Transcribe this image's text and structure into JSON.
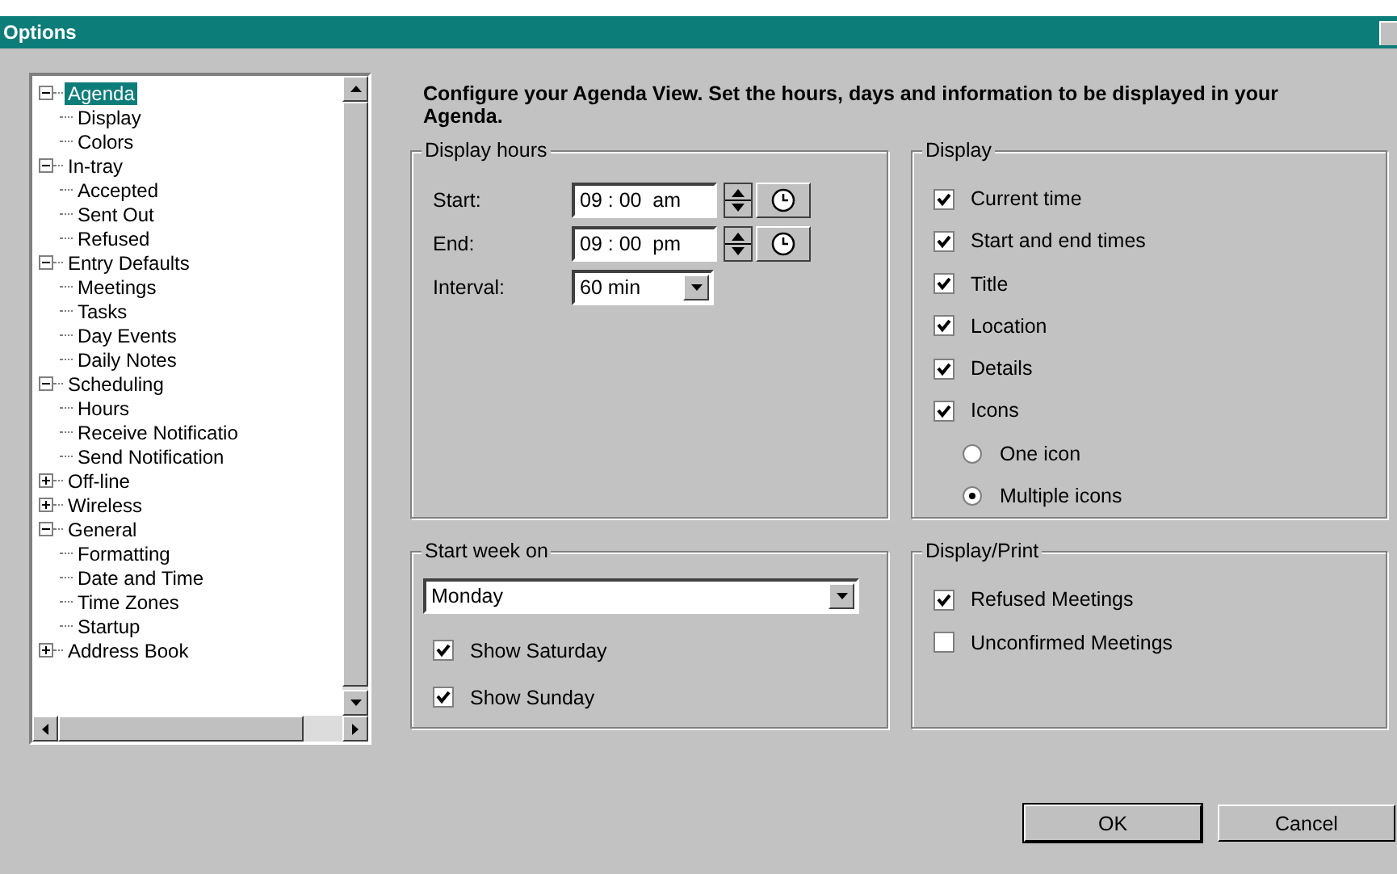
{
  "window": {
    "title": "Options"
  },
  "tree": [
    {
      "label": "Agenda",
      "expanded": true,
      "selected": true,
      "children": [
        {
          "label": "Display",
          "selected": false
        },
        {
          "label": "Colors",
          "selected": false
        }
      ]
    },
    {
      "label": "In-tray",
      "expanded": true,
      "selected": false,
      "children": [
        {
          "label": "Accepted",
          "selected": false
        },
        {
          "label": "Sent Out",
          "selected": false
        },
        {
          "label": "Refused",
          "selected": false
        }
      ]
    },
    {
      "label": "Entry Defaults",
      "expanded": true,
      "selected": false,
      "children": [
        {
          "label": "Meetings",
          "selected": false
        },
        {
          "label": "Tasks",
          "selected": false
        },
        {
          "label": "Day Events",
          "selected": false
        },
        {
          "label": "Daily Notes",
          "selected": false
        }
      ]
    },
    {
      "label": "Scheduling",
      "expanded": true,
      "selected": false,
      "children": [
        {
          "label": "Hours",
          "selected": false
        },
        {
          "label": "Receive Notificatio",
          "selected": false
        },
        {
          "label": "Send Notification",
          "selected": false
        }
      ]
    },
    {
      "label": "Off-line",
      "expanded": false,
      "selected": false
    },
    {
      "label": "Wireless",
      "expanded": false,
      "selected": false
    },
    {
      "label": "General",
      "expanded": true,
      "selected": false,
      "children": [
        {
          "label": "Formatting",
          "selected": false
        },
        {
          "label": "Date and Time",
          "selected": false
        },
        {
          "label": "Time Zones",
          "selected": false
        },
        {
          "label": "Startup",
          "selected": false
        }
      ]
    },
    {
      "label": "Address Book",
      "expanded": false,
      "selected": false
    }
  ],
  "heading": "Configure your Agenda View. Set the hours, days and information to be displayed in your Agenda.",
  "display_hours": {
    "title": "Display hours",
    "start": {
      "label": "Start:",
      "value": "09 : 00  am"
    },
    "end": {
      "label": "End:",
      "value": "09 : 00  pm"
    },
    "interval": {
      "label": "Interval:",
      "value": "60 min"
    }
  },
  "display": {
    "title": "Display",
    "items": [
      {
        "kind": "checkbox",
        "label": "Current time",
        "checked": true
      },
      {
        "kind": "checkbox",
        "label": "Start and end times",
        "checked": true
      },
      {
        "kind": "checkbox",
        "label": "Title",
        "checked": true
      },
      {
        "kind": "checkbox",
        "label": "Location",
        "checked": true
      },
      {
        "kind": "checkbox",
        "label": "Details",
        "checked": true
      },
      {
        "kind": "checkbox",
        "label": "Icons",
        "checked": true
      },
      {
        "kind": "radio",
        "label": "One icon",
        "selected": false
      },
      {
        "kind": "radio",
        "label": "Multiple icons",
        "selected": true
      }
    ]
  },
  "start_week": {
    "title": "Start week on",
    "value": "Monday",
    "options": [
      {
        "label": "Show Saturday",
        "checked": true
      },
      {
        "label": "Show Sunday",
        "checked": true
      }
    ]
  },
  "display_print": {
    "title": "Display/Print",
    "options": [
      {
        "label": "Refused Meetings",
        "checked": true
      },
      {
        "label": "Unconfirmed Meetings",
        "checked": false
      }
    ]
  },
  "buttons": [
    "OK",
    "Cancel"
  ]
}
